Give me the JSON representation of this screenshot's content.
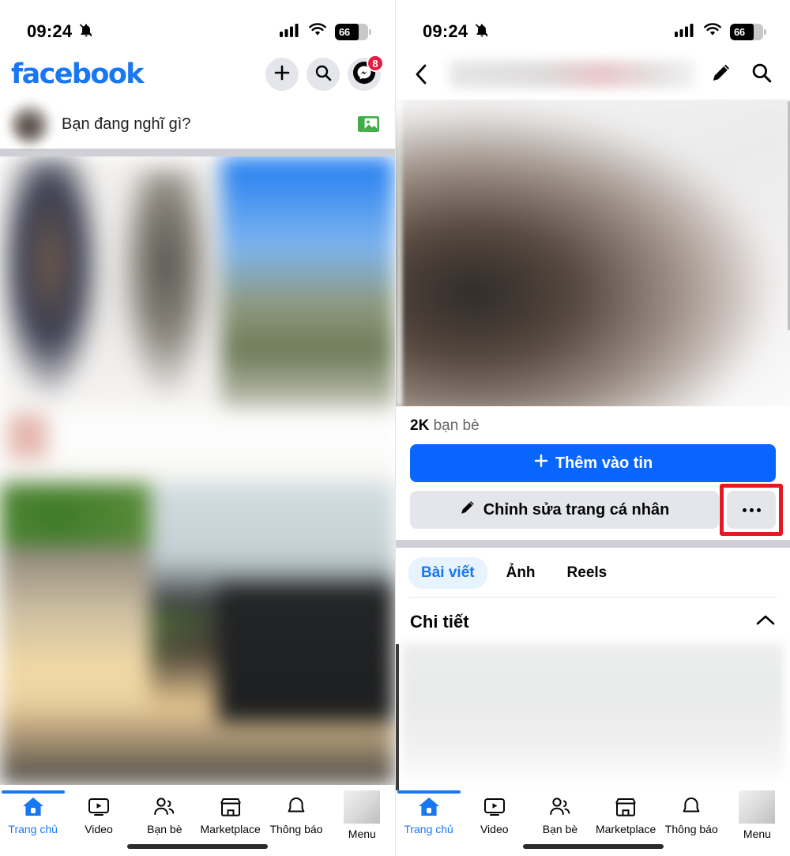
{
  "status_bar": {
    "time": "09:24",
    "mute_icon": "bell-slash-icon",
    "signal_icon": "cellular-signal-icon",
    "wifi_icon": "wifi-icon",
    "battery_level": "66"
  },
  "left_screen": {
    "header": {
      "logo_text": "facebook",
      "create_button": "plus-icon",
      "search_button": "search-icon",
      "messenger_button": "messenger-icon",
      "messenger_badge": "8"
    },
    "composer": {
      "avatar": "user-avatar",
      "placeholder": "Bạn đang nghĩ gì?",
      "photo_button": "photo-library-icon"
    },
    "feed": {
      "content": "blurred-feed-content"
    }
  },
  "right_screen": {
    "header": {
      "back_button": "chevron-left-icon",
      "title": "",
      "edit_button": "pencil-icon",
      "search_button": "search-icon"
    },
    "profile": {
      "photo": "blurred-profile-photo",
      "friends_count": "2K",
      "friends_label": "bạn bè"
    },
    "actions": {
      "add_to_story": "Thêm vào tin",
      "add_to_story_icon": "plus-icon",
      "edit_profile": "Chỉnh sửa trang cá nhân",
      "edit_profile_icon": "pencil-icon",
      "more_button": "ellipsis-icon",
      "highlight_color": "#e21b22"
    },
    "tabs": [
      {
        "label": "Bài viết",
        "active": true
      },
      {
        "label": "Ảnh",
        "active": false
      },
      {
        "label": "Reels",
        "active": false
      }
    ],
    "details_section": {
      "title": "Chi tiết",
      "collapse_icon": "chevron-up-icon",
      "content": "blurred-details-content"
    }
  },
  "bottom_nav": {
    "items": [
      {
        "label": "Trang chủ",
        "icon": "home-icon",
        "active": true
      },
      {
        "label": "Video",
        "icon": "video-icon",
        "active": false
      },
      {
        "label": "Bạn bè",
        "icon": "friends-icon",
        "active": false
      },
      {
        "label": "Marketplace",
        "icon": "marketplace-icon",
        "active": false
      },
      {
        "label": "Thông báo",
        "icon": "bell-icon",
        "active": false
      },
      {
        "label": "Menu",
        "icon": "menu-avatar-icon",
        "active": false
      }
    ]
  },
  "colors": {
    "facebook_blue": "#1877f2",
    "primary_button": "#0866ff",
    "secondary_button": "#e4e6eb",
    "badge_red": "#e41e3f",
    "highlight_red": "#e21b22",
    "divider_grey": "#ced0d4"
  }
}
